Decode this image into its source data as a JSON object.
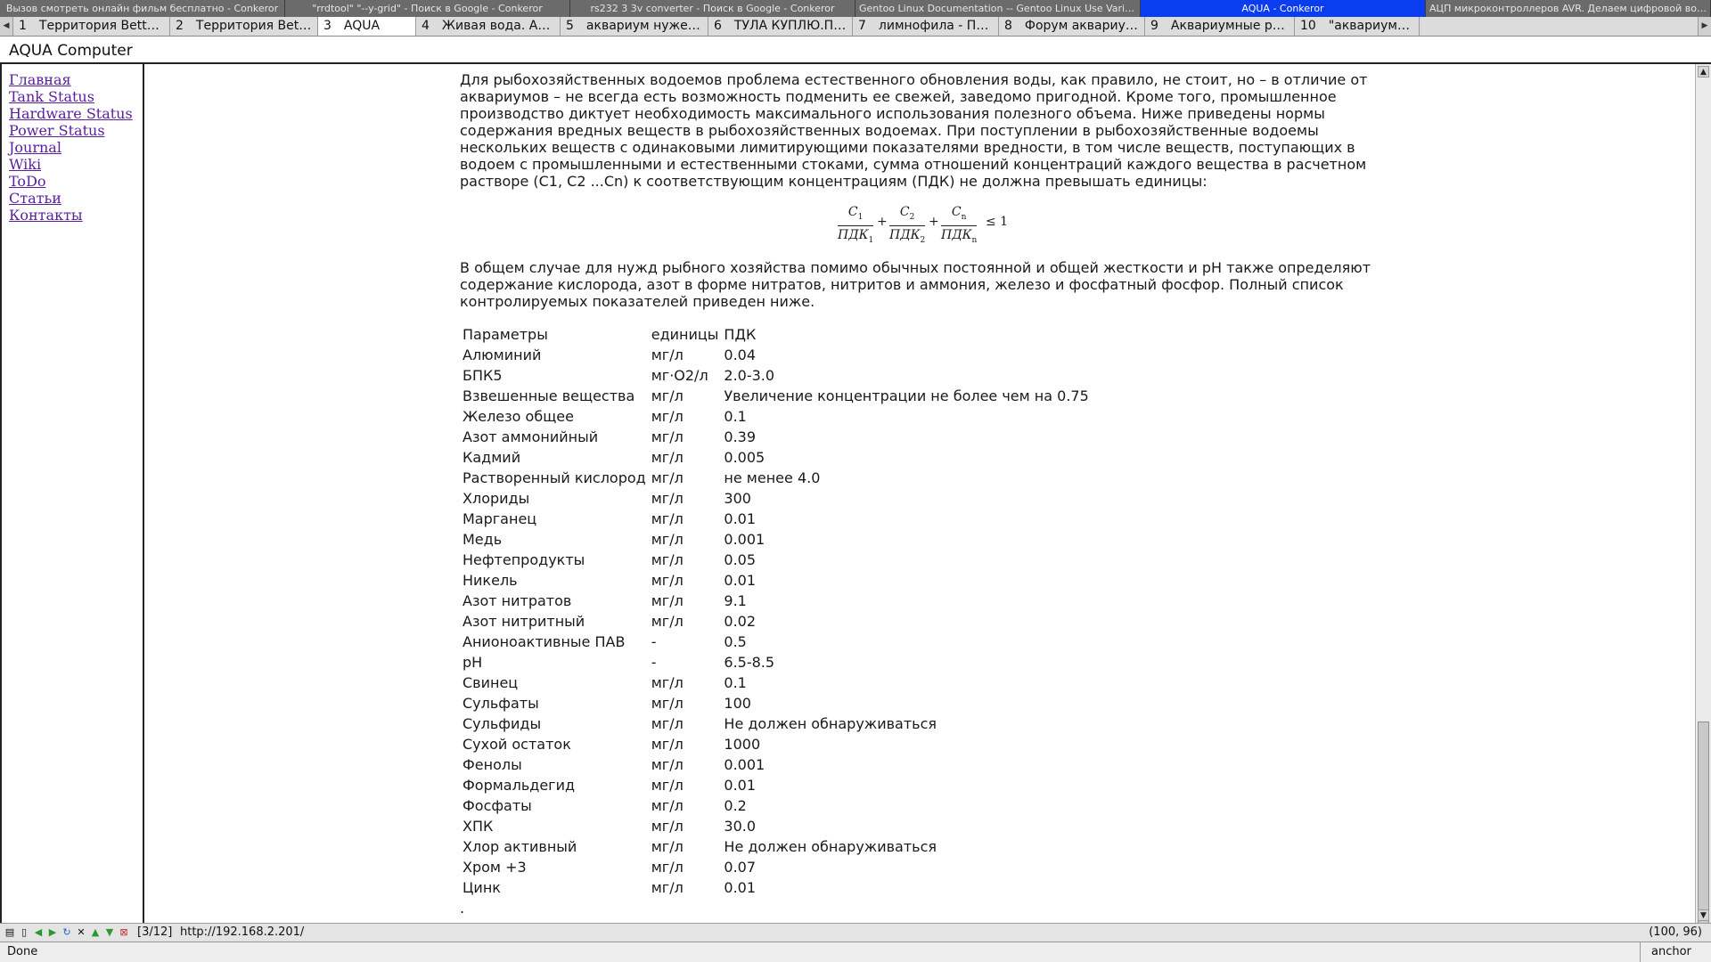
{
  "window_tabs": [
    {
      "label": "Вызов смотреть онлайн фильм бесплатно - Conkeror",
      "active": false
    },
    {
      "label": "\"rrdtool\" \"--y-grid\" - Поиск в Google - Conkeror",
      "active": false
    },
    {
      "label": "rs232 3 3v converter - Поиск в Google - Conkeror",
      "active": false
    },
    {
      "label": "Gentoo Linux Documentation -- Gentoo Linux Use Variable Desc...",
      "active": false
    },
    {
      "label": "AQUA - Conkeror",
      "active": true
    },
    {
      "label": "АЦП микроконтроллеров AVR. Делаем цифровой вольтметр",
      "active": false
    }
  ],
  "buffer_tabs": [
    {
      "num": "1",
      "label": "Территория Betta Spl..."
    },
    {
      "num": "2",
      "label": "Территория Betta Spl..."
    },
    {
      "num": "3",
      "label": "AQUA"
    },
    {
      "num": "4",
      "label": "Живая вода. Аквари..."
    },
    {
      "num": "5",
      "label": "аквариум нужен ли С..."
    },
    {
      "num": "6",
      "label": "ТУЛА КУПЛЮ.ПРОДА..."
    },
    {
      "num": "7",
      "label": "лимнофила - Поиск в ..."
    },
    {
      "num": "8",
      "label": "Форум аквариумисто..."
    },
    {
      "num": "9",
      "label": "Аквариумные растен..."
    },
    {
      "num": "10",
      "label": "\"аквариум\" \"нит"
    }
  ],
  "header": {
    "title": "AQUA Computer"
  },
  "sidebar": {
    "links": [
      "Главная",
      "Tank Status",
      "Hardware Status",
      "Power Status",
      "Journal",
      "Wiki",
      "ToDo",
      "Статьи",
      "Контакты"
    ]
  },
  "content": {
    "para1": "Для рыбохозяйственных водоемов проблема естественного обновления воды, как правило, не стоит, но – в отличие от аквариумов – не всегда есть возможность подменить ее свежей, заведомо пригодной. Кроме того, промышленное производство диктует необходимость максимального использования полезного объема. Ниже приведены нормы содержания вредных веществ в рыбохозяйственных водоемах. При поступлении в рыбохозяйственные водоемы нескольких веществ с одинаковыми лимитирующими показателями вредности, в том числе веществ, поступающих в водоем с промышленными и естественными стоками, сумма отношений концентраций каждого вещества в расчетном растворе (С1, С2 ...Сn) к соответствующим концентрациям (ПДК) не должна превышать единицы:",
    "formula": {
      "c": "C",
      "pdk": "ПДК",
      "s1": "1",
      "s2": "2",
      "sn": "n",
      "plus": "+",
      "leq": "≤ 1"
    },
    "para2": "В общем случае для нужд рыбного хозяйства помимо обычных постоянной и общей жесткости и рН также определяют содержание кислорода, азот в форме нитратов, нитритов и аммония, железо и фосфатный фосфор. Полный список контролируемых показателей приведен ниже.",
    "table_header": [
      "Параметры",
      "единицы",
      "ПДК"
    ],
    "table_rows": [
      [
        "Алюминий",
        "мг/л",
        "0.04"
      ],
      [
        "БПК5",
        "мг·О2/л",
        "2.0-3.0"
      ],
      [
        "Взвешенные вещества",
        "мг/л",
        "Увеличение концентрации не более чем на 0.75"
      ],
      [
        "Железо общее",
        "мг/л",
        "0.1"
      ],
      [
        "Азот аммонийный",
        "мг/л",
        "0.39"
      ],
      [
        "Кадмий",
        "мг/л",
        "0.005"
      ],
      [
        "Растворенный кислород",
        "мг/л",
        "не менее 4.0"
      ],
      [
        "Хлориды",
        "мг/л",
        "300"
      ],
      [
        "Марганец",
        "мг/л",
        "0.01"
      ],
      [
        "Медь",
        "мг/л",
        "0.001"
      ],
      [
        "Нефтепродукты",
        "мг/л",
        "0.05"
      ],
      [
        "Никель",
        "мг/л",
        "0.01"
      ],
      [
        "Азот нитратов",
        "мг/л",
        "9.1"
      ],
      [
        "Азот нитритный",
        "мг/л",
        "0.02"
      ],
      [
        "Анионоактивные ПАВ",
        "-",
        "0.5"
      ],
      [
        "pH",
        "-",
        "6.5-8.5"
      ],
      [
        "Свинец",
        "мг/л",
        "0.1"
      ],
      [
        "Сульфаты",
        "мг/л",
        "100"
      ],
      [
        "Сульфиды",
        "мг/л",
        "Не должен обнаруживаться"
      ],
      [
        "Сухой остаток",
        "мг/л",
        "1000"
      ],
      [
        "Фенолы",
        "мг/л",
        "0.001"
      ],
      [
        "Формальдегид",
        "мг/л",
        "0.01"
      ],
      [
        "Фосфаты",
        "мг/л",
        "0.2"
      ],
      [
        "ХПК",
        "мг/л",
        "30.0"
      ],
      [
        "Хлор активный",
        "мг/л",
        "Не должен обнаруживаться"
      ],
      [
        "Хром +3",
        "мг/л",
        "0.07"
      ],
      [
        "Цинк",
        "мг/л",
        "0.01"
      ]
    ],
    "trailing": "."
  },
  "modeline": {
    "buffer_count": "[3/12]",
    "url": "http://192.168.2.201/",
    "coords": "(100, 96)"
  },
  "statusbar": {
    "status": "Done",
    "mode": "anchor"
  },
  "colors": {
    "active_window_tab": "#0a3cf0",
    "link": "#5a1ea0"
  }
}
